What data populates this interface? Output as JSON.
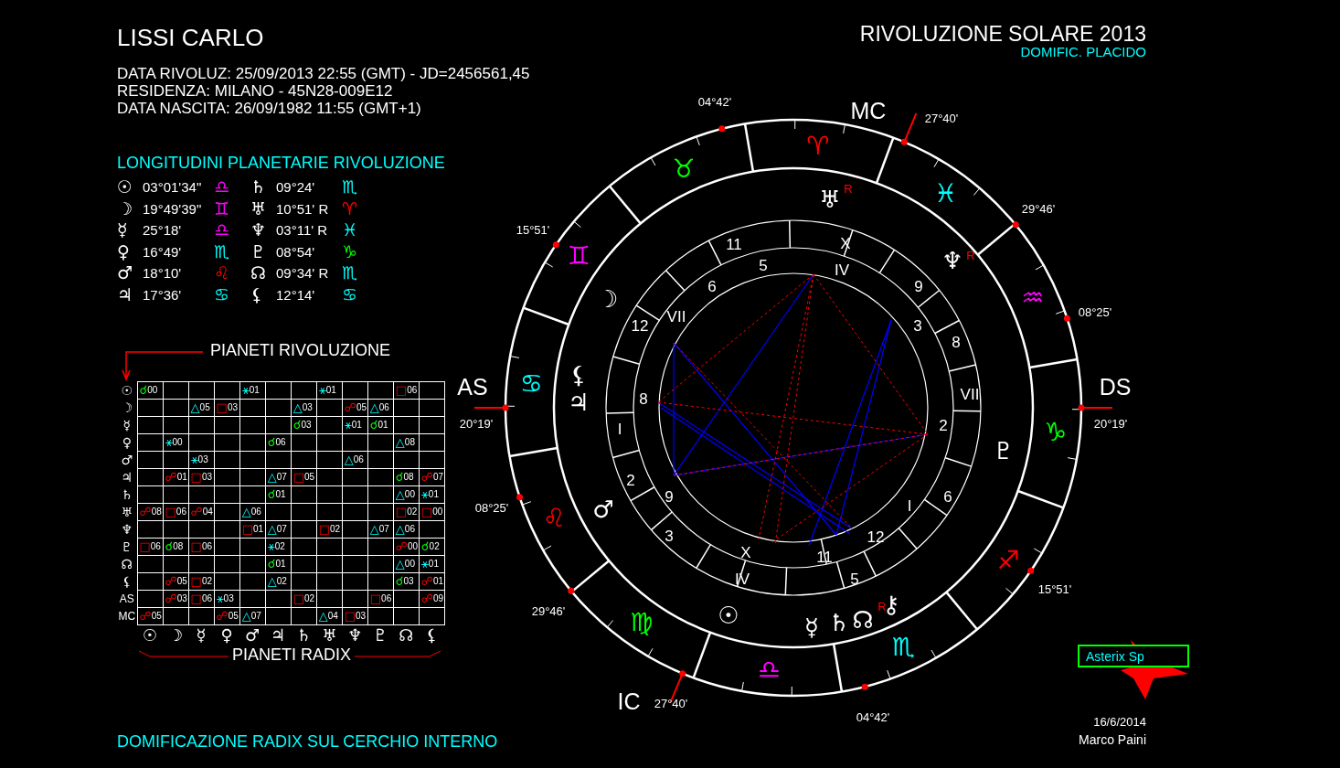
{
  "header": {
    "name": "LISSI CARLO",
    "lines": [
      "DATA RIVOLUZ: 25/09/2013 22:55 (GMT) - JD=2456561,45",
      "RESIDENZA: MILANO  - 45N28-009E12",
      "DATA NASCITA: 26/09/1982 11:55 (GMT+1)"
    ],
    "title": "RIVOLUZIONE SOLARE 2013",
    "subtitle": "DOMIFIC. PLACIDO"
  },
  "longitudes": {
    "title": "LONGITUDINI PLANETARIE RIVOLUZIONE",
    "rows": [
      [
        {
          "glyph": "☉",
          "value": "03°01'34\"",
          "sign": "♎",
          "color": "#ff00ff"
        },
        {
          "glyph": "♄",
          "value": "09°24'",
          "sign": "♏",
          "color": "#00ffff"
        }
      ],
      [
        {
          "glyph": "☽",
          "value": "19°49'39\"",
          "sign": "♊",
          "color": "#ff00ff"
        },
        {
          "glyph": "♅",
          "value": "10°51' R",
          "sign": "♈",
          "color": "#ff0000"
        }
      ],
      [
        {
          "glyph": "☿",
          "value": "25°18'",
          "sign": "♎",
          "color": "#ff00ff"
        },
        {
          "glyph": "♆",
          "value": "03°11' R",
          "sign": "♓",
          "color": "#00ffff"
        }
      ],
      [
        {
          "glyph": "♀",
          "value": "16°49'",
          "sign": "♏",
          "color": "#00ffff"
        },
        {
          "glyph": "♇",
          "value": "08°54'",
          "sign": "♑",
          "color": "#00ff00"
        }
      ],
      [
        {
          "glyph": "♂",
          "value": "18°10'",
          "sign": "♌",
          "color": "#ff0000"
        },
        {
          "glyph": "☊",
          "value": "09°34' R",
          "sign": "♏",
          "color": "#00ffff"
        }
      ],
      [
        {
          "glyph": "♃",
          "value": "17°36'",
          "sign": "♋",
          "color": "#00ffff"
        },
        {
          "glyph": "⚸",
          "value": "12°14'",
          "sign": "♋",
          "color": "#00ffff"
        }
      ]
    ]
  },
  "aspect_grid": {
    "row_title": "PIANETI RIVOLUZIONE",
    "column_title": "PIANETI RADIX",
    "rows": [
      {
        "label": "☉",
        "cells": [
          {
            "kind": "conjunction",
            "glyph": "☌",
            "orb": "00"
          },
          null,
          null,
          null,
          {
            "kind": "sextile",
            "glyph": "⚹",
            "orb": "01"
          },
          null,
          null,
          {
            "kind": "sextile",
            "glyph": "⚹",
            "orb": "01"
          },
          null,
          null,
          {
            "kind": "square",
            "glyph": "□",
            "orb": "06"
          },
          null
        ]
      },
      {
        "label": "☽",
        "cells": [
          null,
          null,
          {
            "kind": "trine",
            "glyph": "△",
            "orb": "05"
          },
          {
            "kind": "square",
            "glyph": "□",
            "orb": "03"
          },
          null,
          null,
          {
            "kind": "trine",
            "glyph": "△",
            "orb": "03"
          },
          null,
          {
            "kind": "opposition",
            "glyph": "☍",
            "orb": "05"
          },
          {
            "kind": "trine",
            "glyph": "△",
            "orb": "06"
          },
          null,
          null
        ]
      },
      {
        "label": "☿",
        "cells": [
          null,
          null,
          null,
          null,
          null,
          null,
          {
            "kind": "conjunction",
            "glyph": "☌",
            "orb": "03"
          },
          null,
          {
            "kind": "sextile",
            "glyph": "⚹",
            "orb": "01"
          },
          {
            "kind": "conjunction",
            "glyph": "☌",
            "orb": "01"
          },
          null,
          null
        ]
      },
      {
        "label": "♀",
        "cells": [
          null,
          {
            "kind": "sextile",
            "glyph": "⚹",
            "orb": "00"
          },
          null,
          null,
          null,
          {
            "kind": "conjunction",
            "glyph": "☌",
            "orb": "06"
          },
          null,
          null,
          null,
          null,
          {
            "kind": "trine",
            "glyph": "△",
            "orb": "08"
          },
          null
        ]
      },
      {
        "label": "♂",
        "cells": [
          null,
          null,
          {
            "kind": "sextile",
            "glyph": "⚹",
            "orb": "03"
          },
          null,
          null,
          null,
          null,
          null,
          {
            "kind": "trine",
            "glyph": "△",
            "orb": "06"
          },
          null,
          null,
          null
        ]
      },
      {
        "label": "♃",
        "cells": [
          null,
          {
            "kind": "opposition",
            "glyph": "☍",
            "orb": "01"
          },
          {
            "kind": "square",
            "glyph": "□",
            "orb": "03"
          },
          null,
          null,
          {
            "kind": "trine",
            "glyph": "△",
            "orb": "07"
          },
          {
            "kind": "square",
            "glyph": "□",
            "orb": "05"
          },
          null,
          null,
          null,
          {
            "kind": "conjunction",
            "glyph": "☌",
            "orb": "08"
          },
          {
            "kind": "opposition",
            "glyph": "☍",
            "orb": "07"
          }
        ]
      },
      {
        "label": "♄",
        "cells": [
          null,
          null,
          null,
          null,
          null,
          {
            "kind": "conjunction",
            "glyph": "☌",
            "orb": "01"
          },
          null,
          null,
          null,
          null,
          {
            "kind": "trine",
            "glyph": "△",
            "orb": "00"
          },
          {
            "kind": "sextile",
            "glyph": "⚹",
            "orb": "01"
          }
        ]
      },
      {
        "label": "♅",
        "cells": [
          {
            "kind": "opposition",
            "glyph": "☍",
            "orb": "08"
          },
          {
            "kind": "square",
            "glyph": "□",
            "orb": "06"
          },
          {
            "kind": "opposition",
            "glyph": "☍",
            "orb": "04"
          },
          null,
          {
            "kind": "trine",
            "glyph": "△",
            "orb": "06"
          },
          null,
          null,
          null,
          null,
          null,
          {
            "kind": "square",
            "glyph": "□",
            "orb": "02"
          },
          {
            "kind": "square",
            "glyph": "□",
            "orb": "00"
          }
        ]
      },
      {
        "label": "♆",
        "cells": [
          null,
          null,
          null,
          null,
          {
            "kind": "square",
            "glyph": "□",
            "orb": "01"
          },
          {
            "kind": "trine",
            "glyph": "△",
            "orb": "07"
          },
          null,
          {
            "kind": "square",
            "glyph": "□",
            "orb": "02"
          },
          null,
          {
            "kind": "trine",
            "glyph": "△",
            "orb": "07"
          },
          {
            "kind": "trine",
            "glyph": "△",
            "orb": "06"
          },
          null
        ]
      },
      {
        "label": "♇",
        "cells": [
          {
            "kind": "square",
            "glyph": "□",
            "orb": "06"
          },
          {
            "kind": "conjunction",
            "glyph": "☌",
            "orb": "08"
          },
          {
            "kind": "square",
            "glyph": "□",
            "orb": "06"
          },
          null,
          null,
          {
            "kind": "sextile",
            "glyph": "⚹",
            "orb": "02"
          },
          null,
          null,
          null,
          null,
          {
            "kind": "opposition",
            "glyph": "☍",
            "orb": "00"
          },
          {
            "kind": "conjunction",
            "glyph": "☌",
            "orb": "02"
          }
        ]
      },
      {
        "label": "☊",
        "cells": [
          null,
          null,
          null,
          null,
          null,
          {
            "kind": "conjunction",
            "glyph": "☌",
            "orb": "01"
          },
          null,
          null,
          null,
          null,
          {
            "kind": "trine",
            "glyph": "△",
            "orb": "00"
          },
          {
            "kind": "sextile",
            "glyph": "⚹",
            "orb": "01"
          }
        ]
      },
      {
        "label": "⚸",
        "cells": [
          null,
          {
            "kind": "opposition",
            "glyph": "☍",
            "orb": "05"
          },
          {
            "kind": "square",
            "glyph": "□",
            "orb": "02"
          },
          null,
          null,
          {
            "kind": "trine",
            "glyph": "△",
            "orb": "02"
          },
          null,
          null,
          null,
          null,
          {
            "kind": "conjunction",
            "glyph": "☌",
            "orb": "03"
          },
          {
            "kind": "opposition",
            "glyph": "☍",
            "orb": "01"
          }
        ]
      },
      {
        "label": "AS",
        "cells": [
          null,
          {
            "kind": "opposition",
            "glyph": "☍",
            "orb": "03"
          },
          {
            "kind": "square",
            "glyph": "□",
            "orb": "06"
          },
          {
            "kind": "sextile",
            "glyph": "⚹",
            "orb": "03"
          },
          null,
          null,
          {
            "kind": "square",
            "glyph": "□",
            "orb": "02"
          },
          null,
          null,
          {
            "kind": "square",
            "glyph": "□",
            "orb": "06"
          },
          null,
          {
            "kind": "opposition",
            "glyph": "☍",
            "orb": "09"
          }
        ]
      },
      {
        "label": "MC",
        "cells": [
          {
            "kind": "opposition",
            "glyph": "☍",
            "orb": "05"
          },
          null,
          null,
          {
            "kind": "opposition",
            "glyph": "☍",
            "orb": "05"
          },
          {
            "kind": "trine",
            "glyph": "△",
            "orb": "07"
          },
          null,
          null,
          {
            "kind": "trine",
            "glyph": "△",
            "orb": "04"
          },
          {
            "kind": "square",
            "glyph": "□",
            "orb": "03"
          },
          null,
          null,
          null
        ]
      }
    ],
    "bottom_axis_labels": [
      "☉",
      "☽",
      "☿",
      "♀",
      "♂",
      "♃",
      "♄",
      "♅",
      "♆",
      "♇",
      "☊",
      "⚸"
    ]
  },
  "wheel": {
    "angles": [
      "MC",
      "AS",
      "DS",
      "IC"
    ],
    "cusp_degrees": [
      "04°42'",
      "27°40'",
      "29°46'",
      "08°25'",
      "20°19'",
      "15°51'",
      "04°42'",
      "27°40'",
      "29°46'",
      "08°25'",
      "20°19'",
      "15°51'"
    ],
    "signs": [
      {
        "glyph": "♈",
        "color": "#ff0000"
      },
      {
        "glyph": "♉",
        "color": "#00ff00"
      },
      {
        "glyph": "♊",
        "color": "#ff00ff"
      },
      {
        "glyph": "♋",
        "color": "#00ffff"
      },
      {
        "glyph": "♌",
        "color": "#ff0000"
      },
      {
        "glyph": "♍",
        "color": "#00ff00"
      },
      {
        "glyph": "♎",
        "color": "#ff00ff"
      },
      {
        "glyph": "♏",
        "color": "#00ffff"
      },
      {
        "glyph": "♐",
        "color": "#ff0000"
      },
      {
        "glyph": "♑",
        "color": "#00ff00"
      },
      {
        "glyph": "♒",
        "color": "#ff00ff"
      },
      {
        "glyph": "♓",
        "color": "#00ffff"
      }
    ],
    "planets": [
      {
        "glyph": "♅",
        "mark": "R"
      },
      {
        "glyph": "♆",
        "mark": "R"
      },
      {
        "glyph": "☽"
      },
      {
        "glyph": "⚸"
      },
      {
        "glyph": "♃"
      },
      {
        "glyph": "♂"
      },
      {
        "glyph": "☉"
      },
      {
        "glyph": "☿"
      },
      {
        "glyph": "♄"
      },
      {
        "glyph": "☊"
      },
      {
        "glyph": "⚷",
        "mark": "R"
      },
      {
        "glyph": "♇"
      }
    ],
    "house_numbers": [
      "11",
      "X",
      "5",
      "IV",
      "6",
      "9",
      "12",
      "VII",
      "3",
      "8",
      "8",
      "VII",
      "I",
      "2",
      "2",
      "9",
      "6",
      "I",
      "3",
      "12",
      "X",
      "11",
      "IV",
      "5"
    ]
  },
  "footer": {
    "note": "DOMIFICAZIONE RADIX SUL CERCHIO INTERNO",
    "logo": "Asterix Sp",
    "date": "16/6/2014",
    "author": "Marco Paini"
  }
}
